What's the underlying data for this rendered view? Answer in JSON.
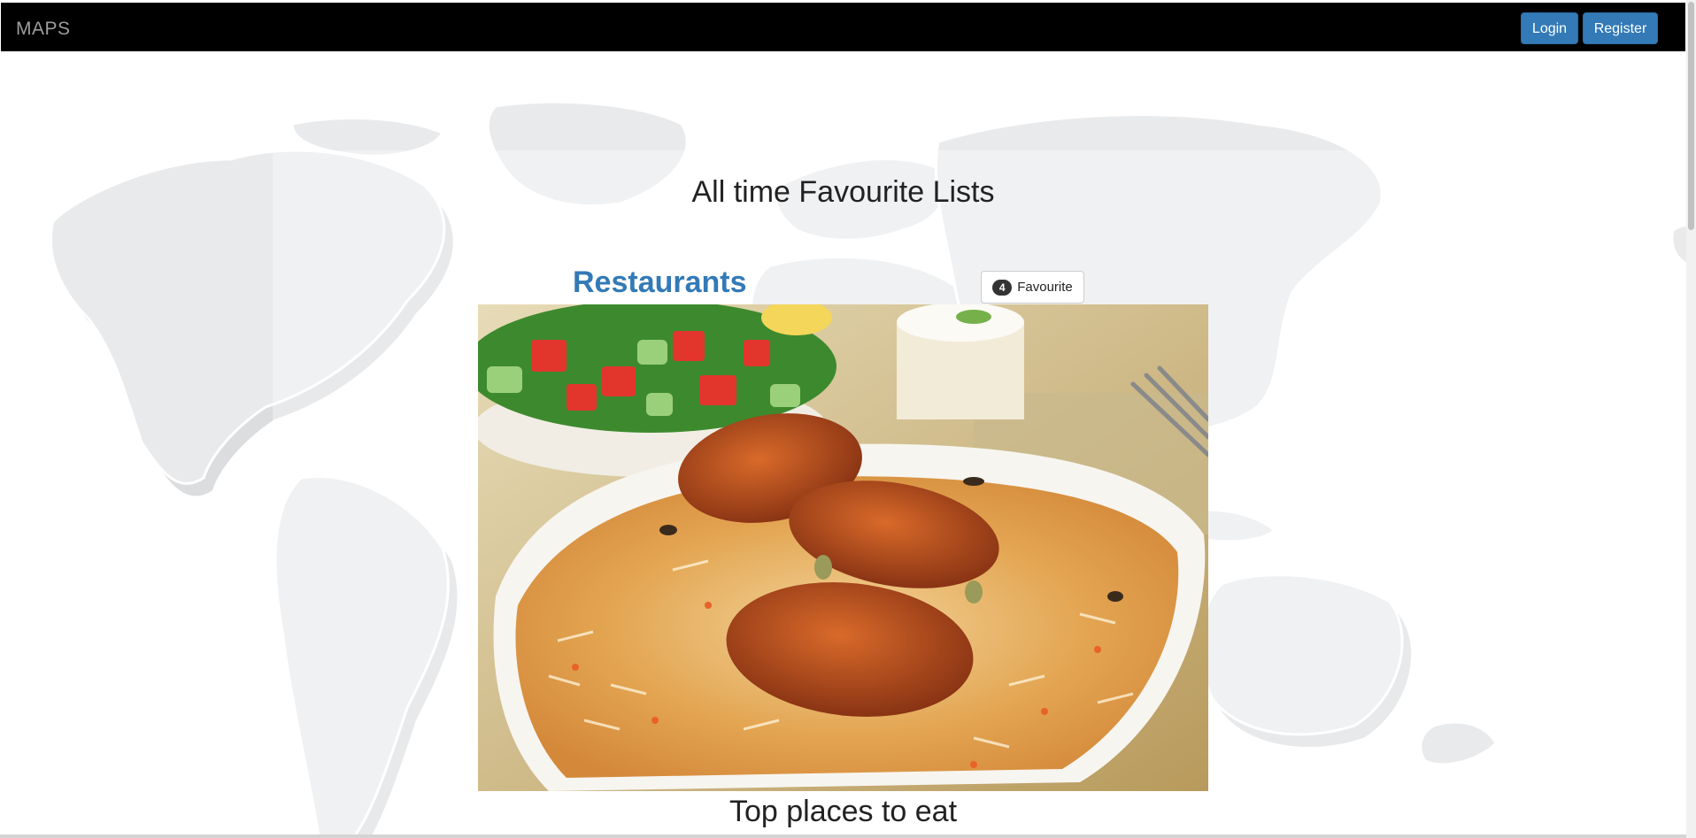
{
  "navbar": {
    "brand": "MAPS",
    "login_label": "Login",
    "register_label": "Register"
  },
  "main": {
    "title": "All time Favourite Lists",
    "lists": [
      {
        "title": "Restaurants",
        "favourite_count": "4",
        "favourite_label": "Favourite",
        "caption": "Top places to eat"
      }
    ]
  },
  "colors": {
    "navbar_bg": "#000000",
    "brand_text": "#9d9d9d",
    "primary_button": "#337ab7",
    "list_title": "#337ab7",
    "map_land": "#e9eaec"
  },
  "icons": {
    "background": "world-map-graphic",
    "image": "biryani-food-photo"
  }
}
